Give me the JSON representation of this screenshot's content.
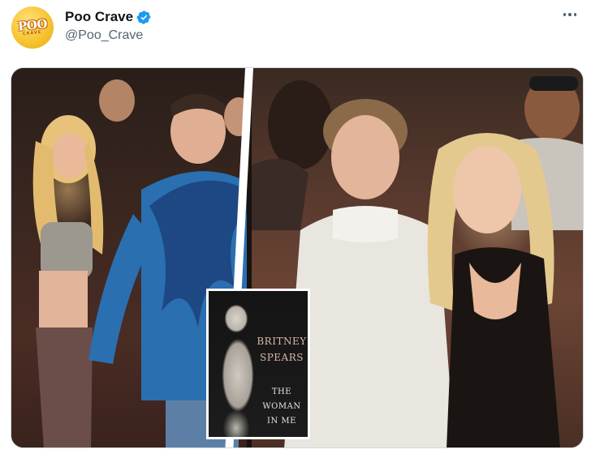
{
  "account": {
    "display_name": "Poo Crave",
    "handle": "@Poo_Crave",
    "verified": true,
    "avatar_logo_main": "POO",
    "avatar_logo_sub": "CRAVE",
    "verified_color": "#1d9bf0",
    "avatar_color": "#f7c431"
  },
  "menu": {
    "icon": "more-horizontal-icon"
  },
  "media": {
    "book_cover": {
      "author_line1": "BRITNEY",
      "author_line2": "SPEARS",
      "title_line1": "THE",
      "title_line2": "WOMAN",
      "title_line3": "IN ME"
    }
  }
}
